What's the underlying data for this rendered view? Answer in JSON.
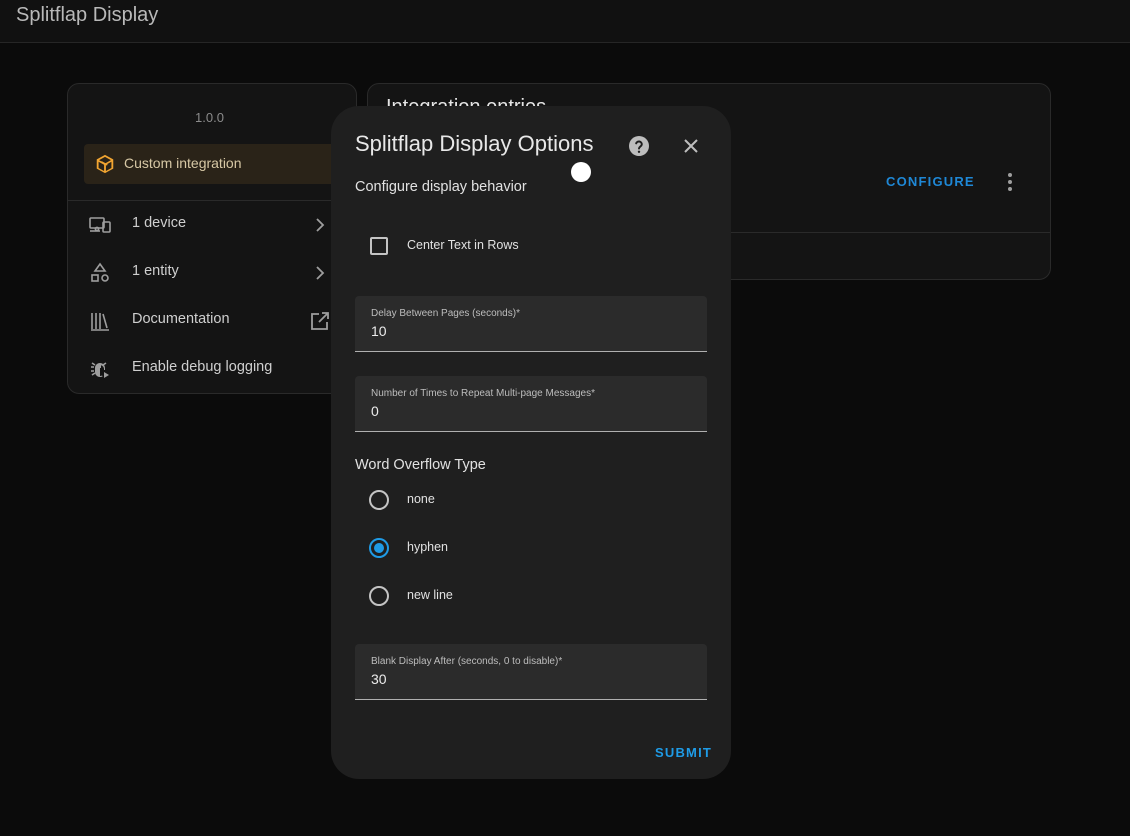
{
  "app": {
    "title": "Splitflap Display"
  },
  "left_card": {
    "version": "1.0.0",
    "custom_label": "Custom integration",
    "rows": [
      {
        "label": "1 device",
        "icon": "devices-icon"
      },
      {
        "label": "1 entity",
        "icon": "shapes-icon"
      },
      {
        "label": "Documentation",
        "icon": "book-icon"
      },
      {
        "label": "Enable debug logging",
        "icon": "bug-icon"
      }
    ]
  },
  "right_card": {
    "heading": "Integration entries",
    "configure_label": "CONFIGURE"
  },
  "dialog": {
    "title": "Splitflap Display Options",
    "subtitle": "Configure display behavior",
    "center_text_label": "Center Text in Rows",
    "center_text_checked": false,
    "delay": {
      "label": "Delay Between Pages (seconds)*",
      "value": "10"
    },
    "repeat": {
      "label": "Number of Times to Repeat Multi-page Messages*",
      "value": "0"
    },
    "overflow": {
      "title": "Word Overflow Type",
      "options": [
        "none",
        "hyphen",
        "new line"
      ],
      "selected": "hyphen"
    },
    "blank": {
      "label": "Blank Display After (seconds, 0 to disable)*",
      "value": "30"
    },
    "submit_label": "SUBMIT"
  },
  "colors": {
    "accent": "#1f9be6",
    "custom_integration": "#f2a531"
  }
}
